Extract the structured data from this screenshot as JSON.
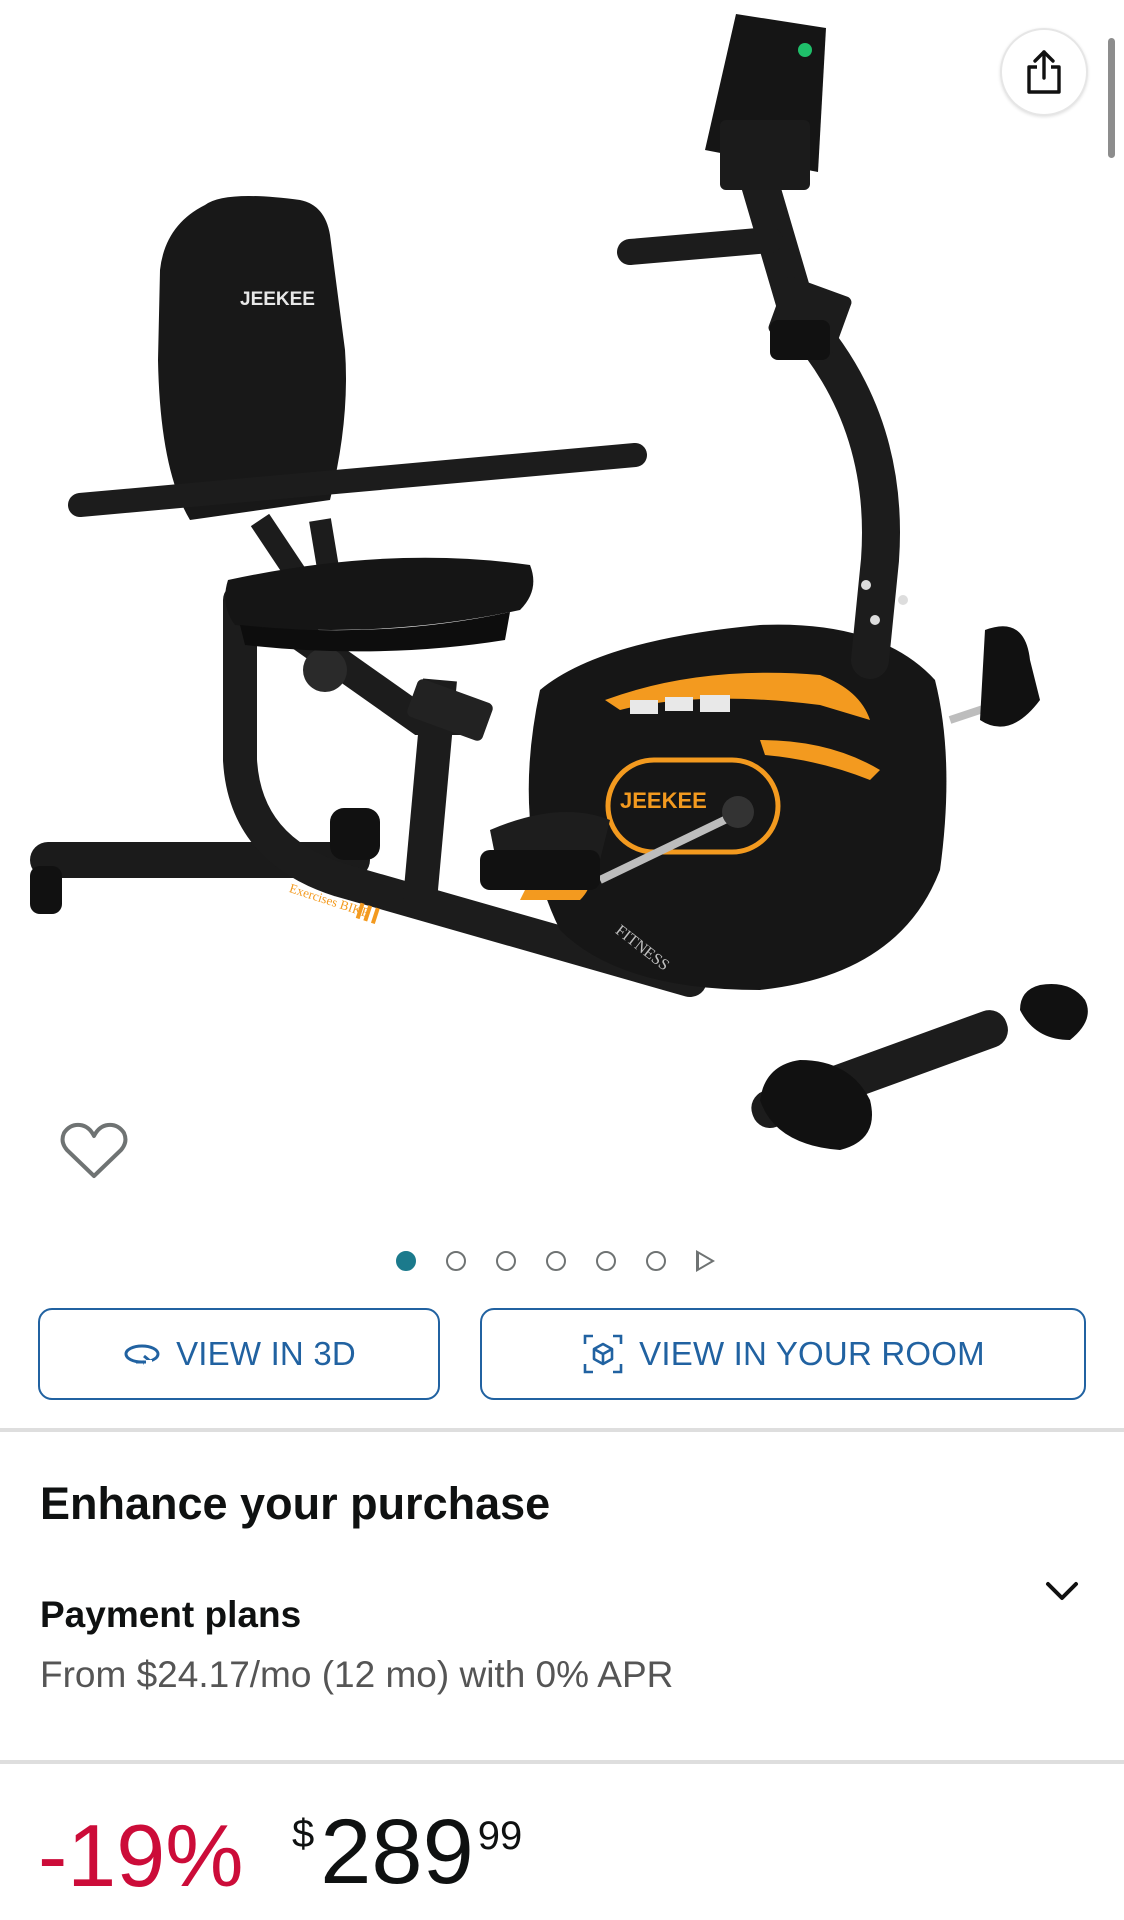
{
  "product_image": {
    "brand_text": "JEEKEE",
    "seat_brand_text": "JEEKEE",
    "frame_label": "Exercises BIKE",
    "side_text": "FITNESS"
  },
  "gallery": {
    "dot_count": 6,
    "active_index": 0
  },
  "actions": {
    "view_3d_label": "VIEW IN 3D",
    "view_room_label": "VIEW IN YOUR ROOM"
  },
  "enhance": {
    "title": "Enhance your purchase",
    "payment_title": "Payment plans",
    "payment_detail": "From $24.17/mo (12 mo) with 0% APR"
  },
  "price": {
    "discount": "-19%",
    "symbol": "$",
    "whole": "289",
    "fraction": "99"
  },
  "colors": {
    "link": "#2162a1",
    "discount": "#cc0c39",
    "accent": "#1b7a8c",
    "bike_orange": "#f39a1f"
  },
  "icons": [
    "share-icon",
    "heart-icon",
    "rotate-3d-icon",
    "ar-cube-icon",
    "chevron-down-icon",
    "play-icon"
  ]
}
